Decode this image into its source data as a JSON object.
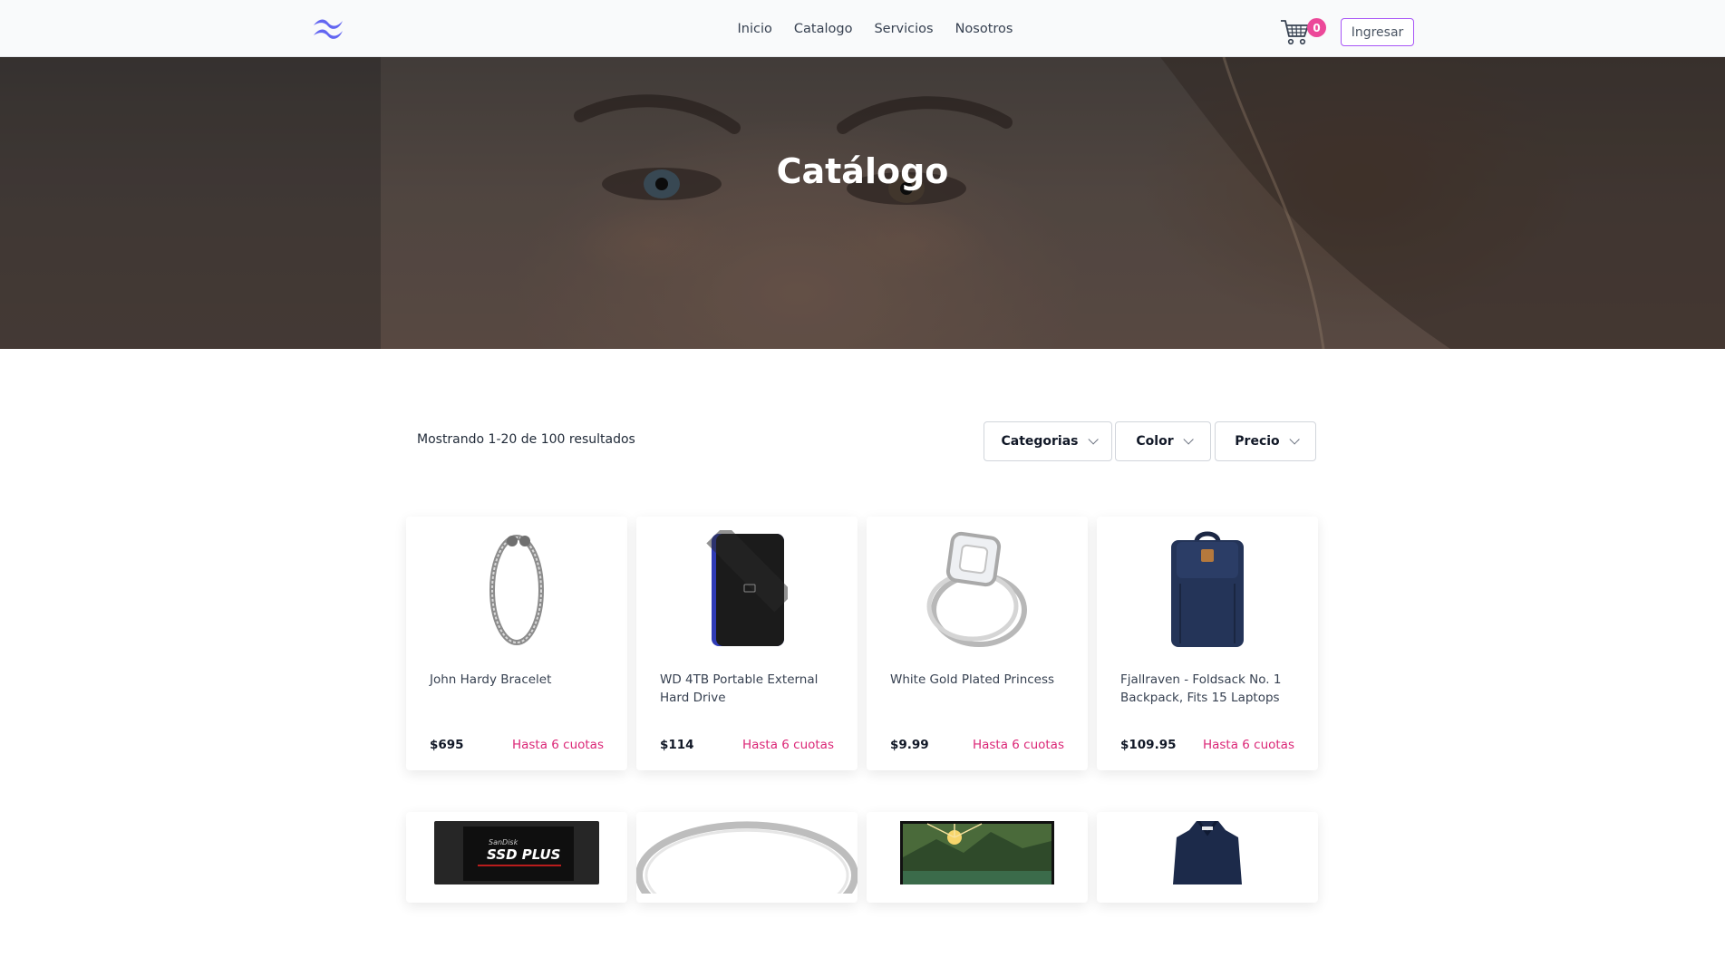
{
  "nav": {
    "links": [
      "Inicio",
      "Catalogo",
      "Servicios",
      "Nosotros"
    ],
    "cart_count": "0",
    "login_label": "Ingresar"
  },
  "hero": {
    "title": "Catálogo"
  },
  "toolbar": {
    "result_count": "Mostrando 1-20 de 100 resultados",
    "filters": [
      "Categorias",
      "Color",
      "Precio"
    ]
  },
  "products": [
    {
      "name": "John Hardy Bracelet",
      "price": "$695",
      "cuotas": "Hasta 6 cuotas",
      "icon": "bracelet-image"
    },
    {
      "name": "WD 4TB Portable External Hard Drive",
      "price": "$114",
      "cuotas": "Hasta 6 cuotas",
      "icon": "hard-drive-image"
    },
    {
      "name": "White Gold Plated Princess",
      "price": "$9.99",
      "cuotas": "Hasta 6 cuotas",
      "icon": "ring-image"
    },
    {
      "name": "Fjallraven - Foldsack No. 1 Backpack, Fits 15 Laptops",
      "price": "$109.95",
      "cuotas": "Hasta 6 cuotas",
      "icon": "backpack-image"
    }
  ],
  "products_row2": [
    {
      "icon": "ssd-image",
      "ssd_label": "SSD PLUS",
      "ssd_brand": "SanDisk"
    },
    {
      "icon": "silver-ring-image"
    },
    {
      "icon": "monitor-image"
    },
    {
      "icon": "jacket-image"
    }
  ],
  "colors": {
    "accent": "#ec4899",
    "cuotas": "#db2777",
    "login_border": "#a855f7",
    "logo": "#6366f1"
  }
}
